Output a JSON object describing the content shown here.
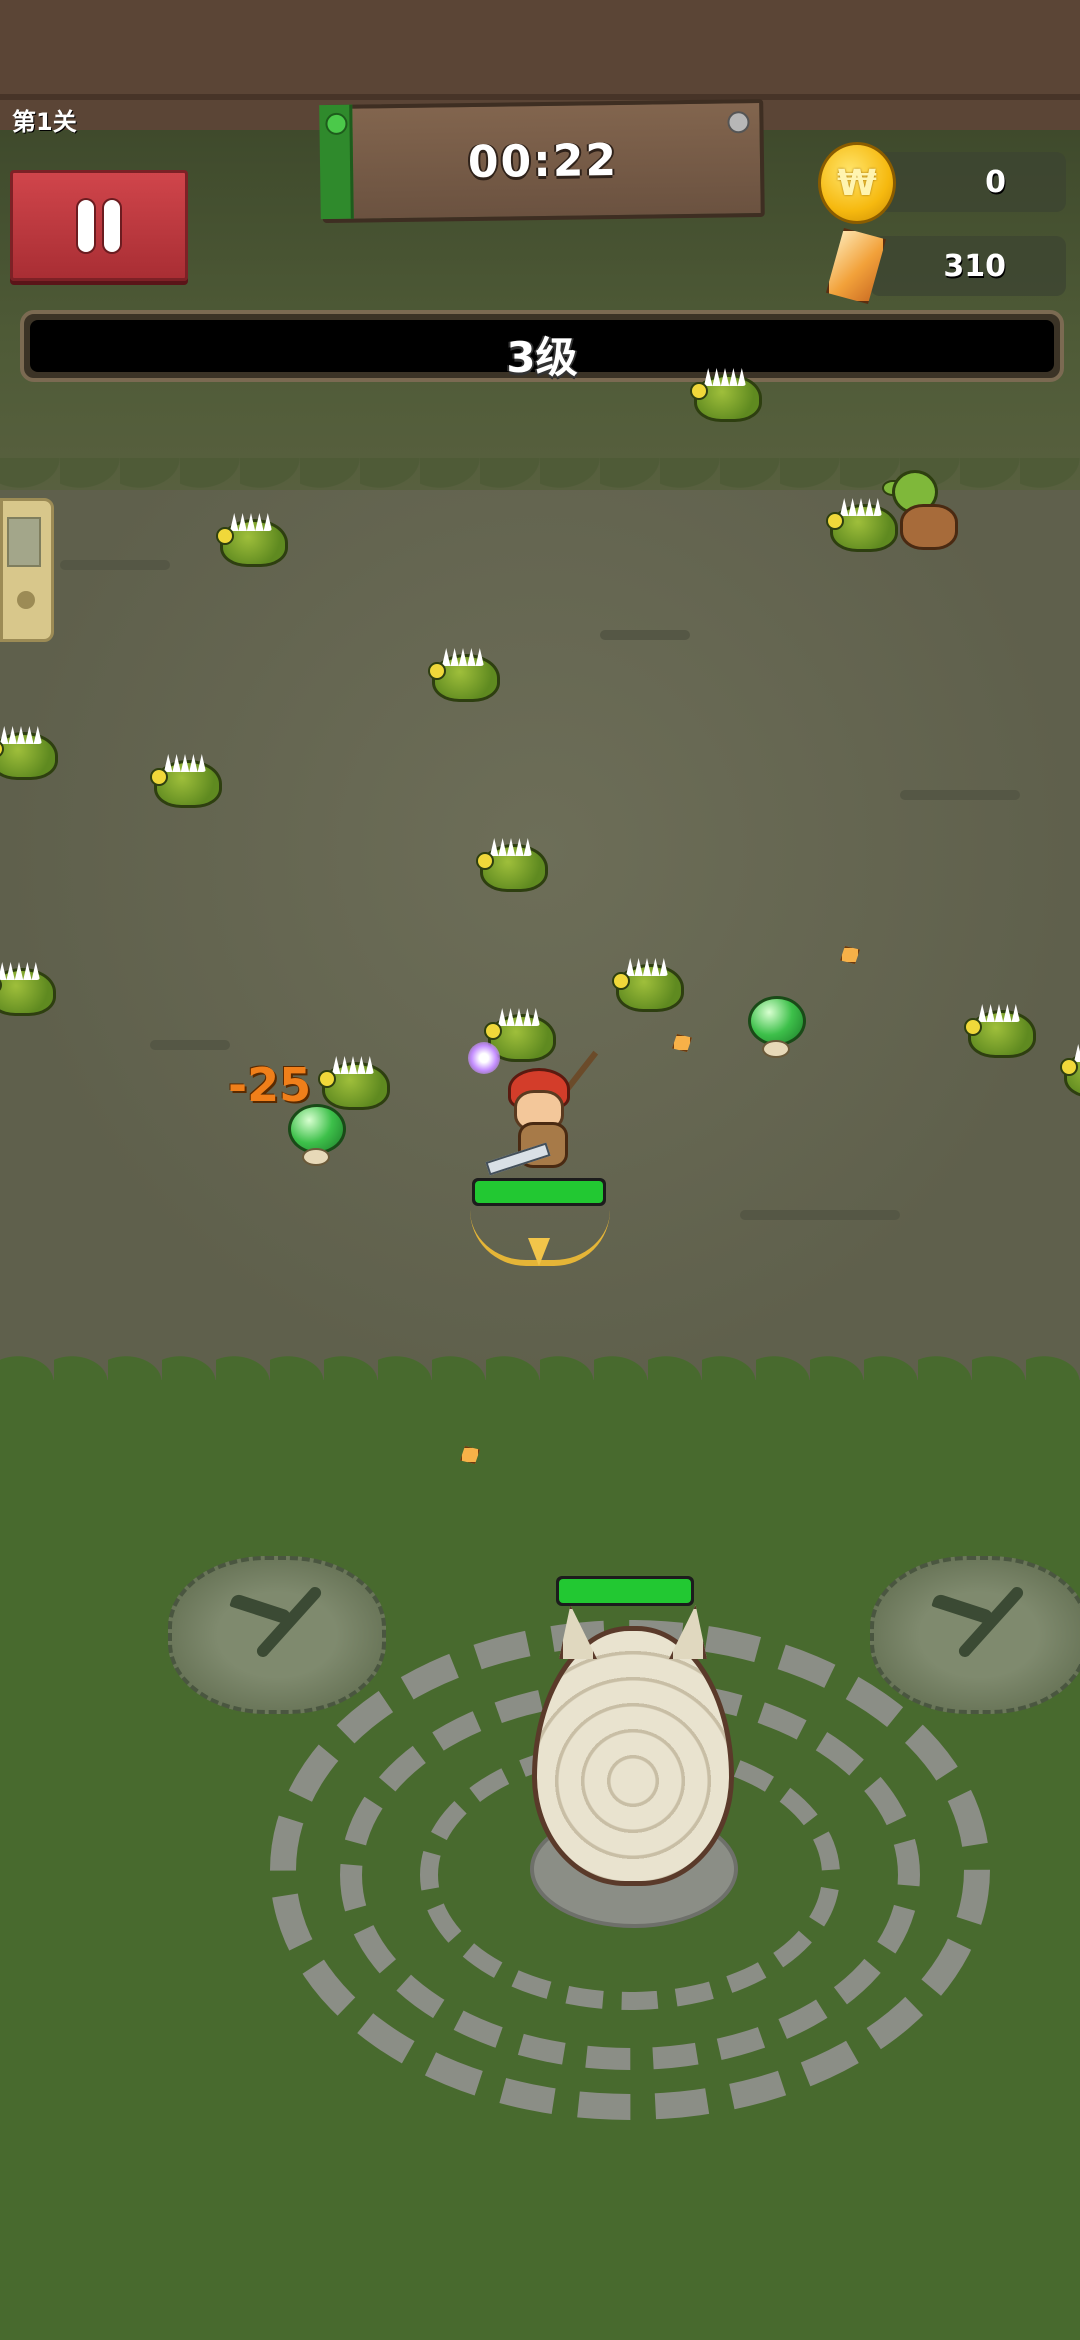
{
  "hud": {
    "level_label": "第1关",
    "timer": "00:22",
    "coins": "0",
    "gems": "310",
    "xp_level_label": "3级",
    "xp_progress": 0.0
  },
  "combat": {
    "damage_number": "-25",
    "hero_hp_fraction": 1.0,
    "egg_hp_fraction": 1.0
  },
  "icons": {
    "pause": "pause-icon",
    "coin": "coin-icon",
    "gem": "gem-icon",
    "pickaxe": "pickaxe-icon"
  },
  "colors": {
    "pause_button": "#c93b41",
    "hp_bar": "#22c832",
    "damage_text": "#f07f1a",
    "xp_bar_bg": "#000000"
  }
}
